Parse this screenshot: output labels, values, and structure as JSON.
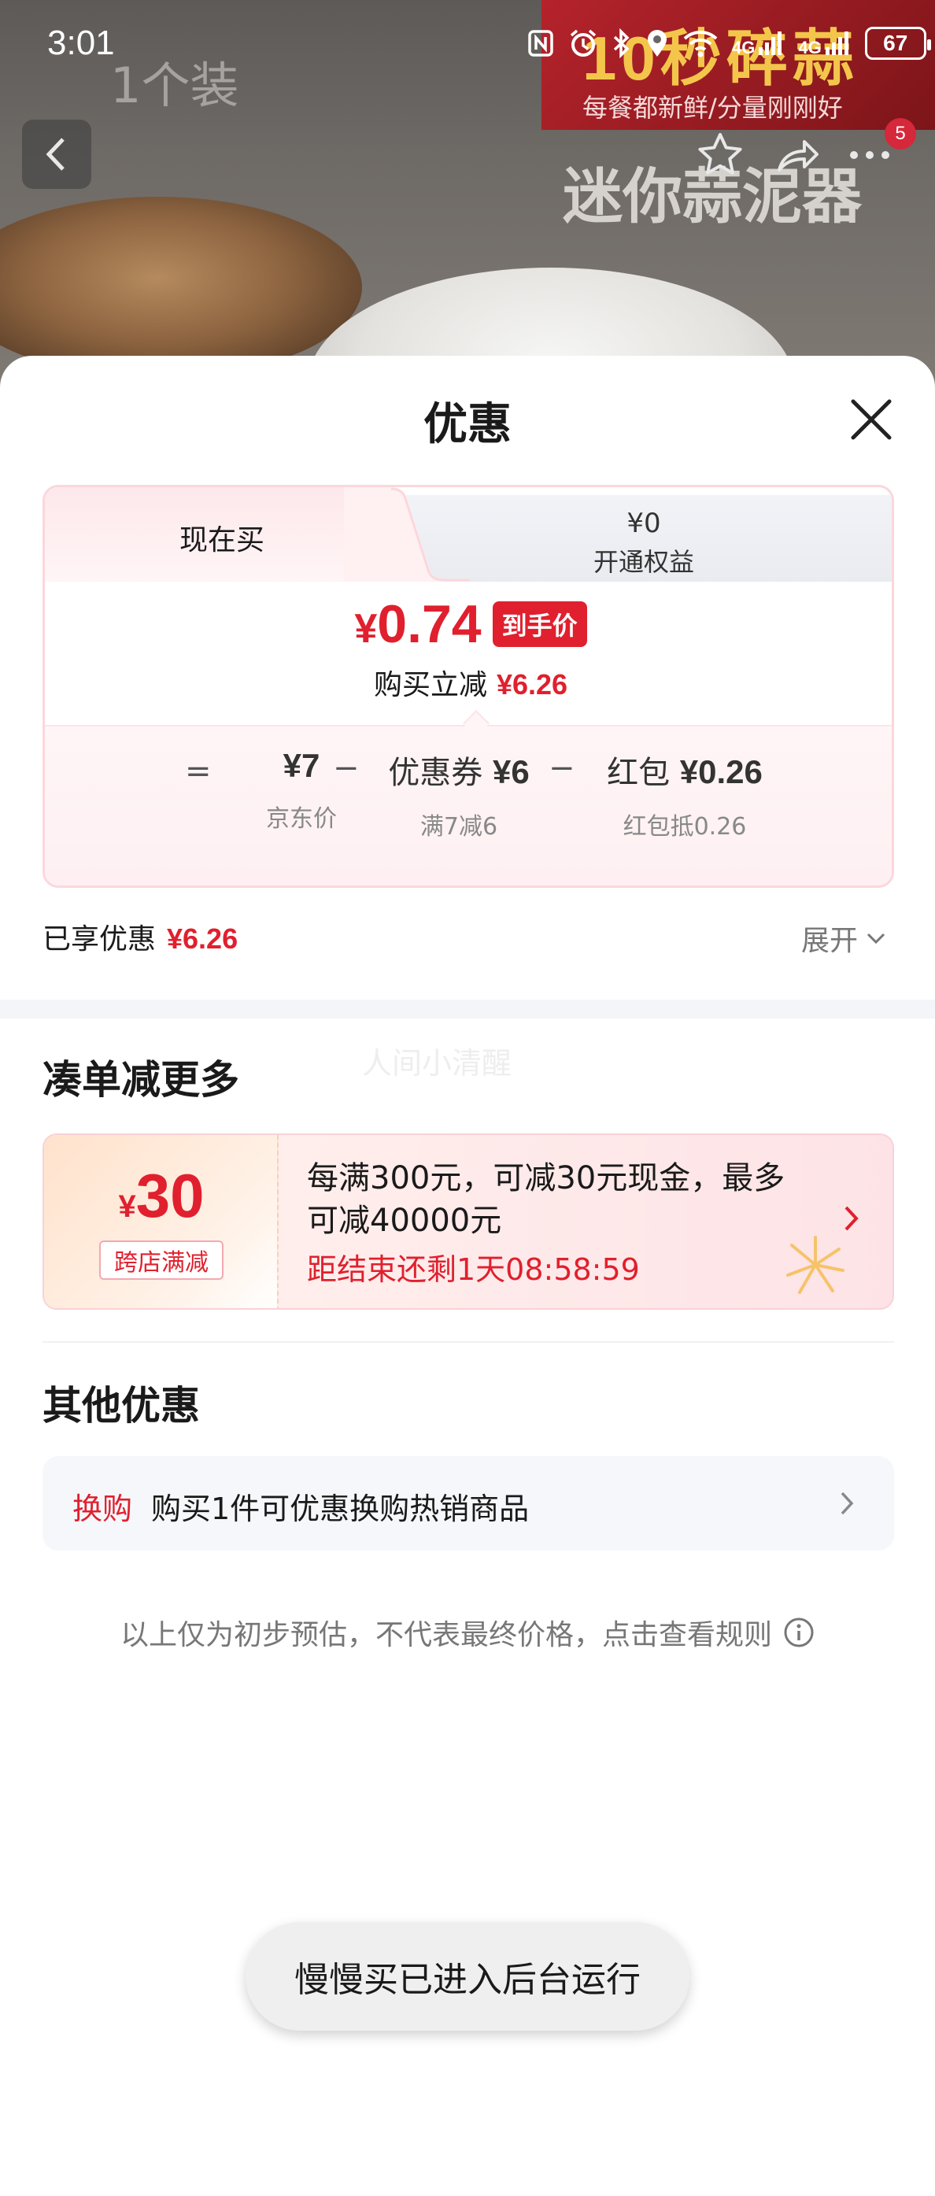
{
  "status_bar": {
    "time": "3:01",
    "network_1": "4G",
    "network_2": "4G",
    "battery": "67"
  },
  "background": {
    "count_label": "1个装",
    "promo_big": "10秒碎蒜",
    "promo_sub": "每餐都新鲜/分量刚刚好",
    "promo_title": "迷你蒜泥器",
    "share_badge": "5"
  },
  "sheet": {
    "title": "优惠"
  },
  "price_card": {
    "tab_now": "现在买",
    "tab_other_price": "¥0",
    "tab_other_label": "开通权益",
    "final_yen": "¥",
    "final_value": "0.74",
    "final_tag": "到手价",
    "save_label": "购买立减",
    "save_value": "¥6.26",
    "equals": "=",
    "minus": "−",
    "jd_price": "¥7",
    "jd_label": "京东价",
    "coupon_name": "优惠券",
    "coupon_value": "¥6",
    "coupon_desc": "满7减6",
    "redpacket_name": "红包",
    "redpacket_value": "¥0.26",
    "redpacket_desc": "红包抵0.26"
  },
  "enjoyed": {
    "label": "已享优惠",
    "value": "¥6.26",
    "expand_label": "展开"
  },
  "watermark": "人间小清醒",
  "more_section": {
    "title": "凑单减更多",
    "promo_yen": "¥",
    "promo_amount": "30",
    "promo_tag": "跨店满减",
    "promo_desc": "每满300元，可减30元现金，最多可减40000元",
    "promo_countdown": "距结束还剩1天08:58:59"
  },
  "other_section": {
    "title": "其他优惠",
    "exchange_tag": "换购",
    "exchange_text": "购买1件可优惠换购热销商品"
  },
  "disclaimer": "以上仅为初步预估，不代表最终价格，点击查看规则",
  "toast": "慢慢买已进入后台运行",
  "colors": {
    "accent_red": "#e0202e",
    "card_border": "#fbd7dc",
    "muted_text": "#777777"
  }
}
